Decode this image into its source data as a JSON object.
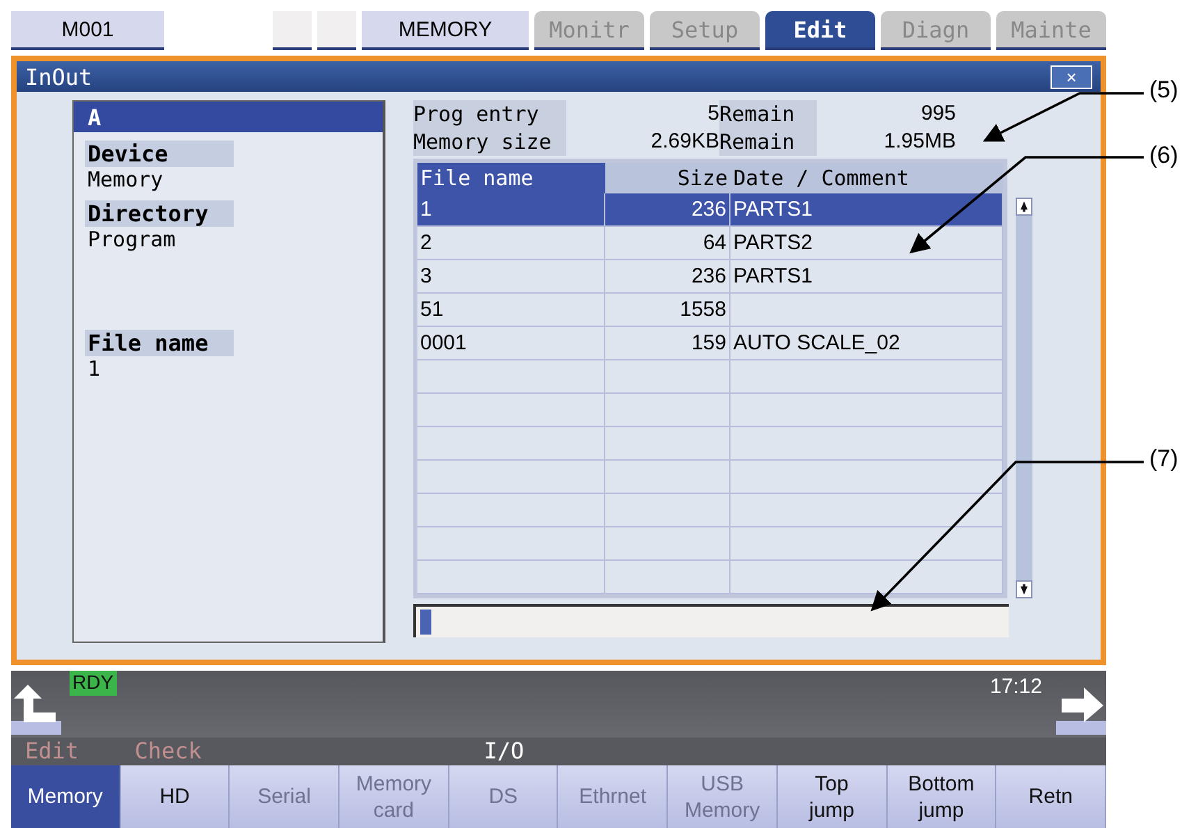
{
  "header": {
    "program": "M001",
    "mode": "MEMORY"
  },
  "tabs": [
    {
      "label": "Monitr",
      "selected": false
    },
    {
      "label": "Setup",
      "selected": false
    },
    {
      "label": "Edit",
      "selected": true
    },
    {
      "label": "Diagn",
      "selected": false
    },
    {
      "label": "Mainte",
      "selected": false
    }
  ],
  "window": {
    "title": "InOut",
    "close": "×"
  },
  "device_panel": {
    "drive": "A",
    "drive_selected": true,
    "fields": [
      {
        "label": "Device",
        "value": "Memory"
      },
      {
        "label": "Directory",
        "value": "Program"
      },
      {
        "label": "File name",
        "value": "1"
      }
    ]
  },
  "summary": [
    {
      "label": "Prog entry",
      "value": "5",
      "remain_label": "Remain",
      "remain_value": "995"
    },
    {
      "label": "Memory size",
      "value": "2.69KB",
      "remain_label": "Remain",
      "remain_value": "1.95MB"
    }
  ],
  "file_table": {
    "columns": [
      "File name",
      "Size",
      "Date / Comment"
    ],
    "rows": [
      {
        "name": "1",
        "size": "236",
        "comment": "PARTS1",
        "selected": true
      },
      {
        "name": "2",
        "size": "64",
        "comment": "PARTS2",
        "selected": false
      },
      {
        "name": "3",
        "size": "236",
        "comment": "PARTS1",
        "selected": false
      },
      {
        "name": "51",
        "size": "1558",
        "selected": false
      },
      {
        "name": "0001",
        "size": "159",
        "comment": "AUTO SCALE_02",
        "selected": false
      }
    ]
  },
  "status_bar": {
    "status": "RDY",
    "time": "17:12"
  },
  "menu_row": {
    "items": [
      {
        "label": "Edit",
        "disabled": true
      },
      {
        "label": "Check",
        "disabled": true
      }
    ],
    "title": "I/O"
  },
  "softkeys": [
    {
      "lines": [
        "Memory"
      ],
      "selected": true,
      "disabled": false
    },
    {
      "lines": [
        "HD"
      ],
      "selected": false,
      "disabled": false
    },
    {
      "lines": [
        "Serial"
      ],
      "selected": false,
      "disabled": true
    },
    {
      "lines": [
        "Memory",
        "card"
      ],
      "selected": false,
      "disabled": true
    },
    {
      "lines": [
        "DS"
      ],
      "selected": false,
      "disabled": true
    },
    {
      "lines": [
        "Ethrnet"
      ],
      "selected": false,
      "disabled": true
    },
    {
      "lines": [
        "USB",
        "Memory"
      ],
      "selected": false,
      "disabled": true
    },
    {
      "lines": [
        "Top",
        "jump"
      ],
      "selected": false,
      "disabled": false
    },
    {
      "lines": [
        "Bottom",
        "jump"
      ],
      "selected": false,
      "disabled": false
    },
    {
      "lines": [
        "Retn"
      ],
      "selected": false,
      "disabled": false
    }
  ],
  "callouts": [
    {
      "label": "(5)"
    },
    {
      "label": "(6)"
    },
    {
      "label": "(7)"
    }
  ]
}
